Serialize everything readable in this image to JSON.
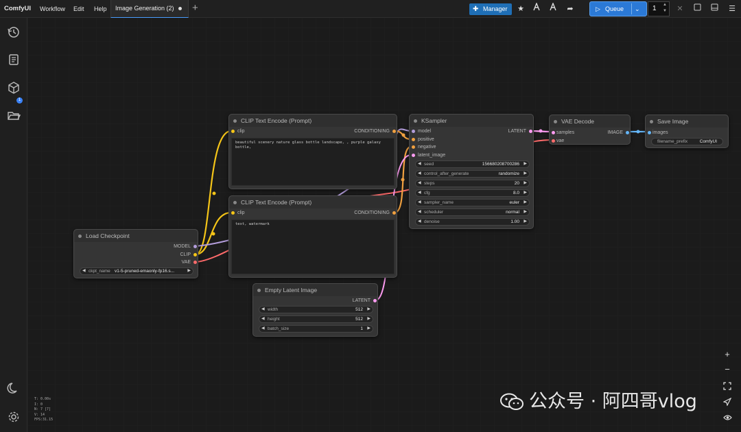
{
  "topbar": {
    "app_name": "ComfyUI",
    "menus": [
      "Workflow",
      "Edit",
      "Help"
    ],
    "tab_title": "Image Generation (2)",
    "manager_label": "Manager",
    "queue_label": "Queue",
    "queue_count": "1"
  },
  "sidebar": {
    "badge_count": "1"
  },
  "stats": [
    "T: 0.00s",
    "I: 0",
    "N: 7 [7]",
    "V: 14",
    "FPS:31.15"
  ],
  "colors": {
    "clip": "#f5c518",
    "conditioning": "#f0a040",
    "model": "#b39ddb",
    "vae": "#ff6b6b",
    "latent": "#ff9cf2",
    "image": "#64b5f6",
    "accent": "#2b79d6"
  },
  "nodes": {
    "clip_pos": {
      "title": "CLIP Text Encode (Prompt)",
      "in_clip": "clip",
      "out": "CONDITIONING",
      "text": "beautiful scenery nature glass bottle landscape, , purple galaxy bottle,"
    },
    "clip_neg": {
      "title": "CLIP Text Encode (Prompt)",
      "in_clip": "clip",
      "out": "CONDITIONING",
      "text": "text, watermark"
    },
    "checkpoint": {
      "title": "Load Checkpoint",
      "out_model": "MODEL",
      "out_clip": "CLIP",
      "out_vae": "VAE",
      "widget_name": "ckpt_name",
      "widget_value": "v1-5-pruned-emaonly-fp16.s..."
    },
    "latent": {
      "title": "Empty Latent Image",
      "out": "LATENT",
      "widgets": [
        {
          "name": "width",
          "value": "512"
        },
        {
          "name": "height",
          "value": "512"
        },
        {
          "name": "batch_size",
          "value": "1"
        }
      ]
    },
    "ksampler": {
      "title": "KSampler",
      "inputs": [
        "model",
        "positive",
        "negative",
        "latent_image"
      ],
      "out": "LATENT",
      "widgets": [
        {
          "name": "seed",
          "value": "156680208700286"
        },
        {
          "name": "control_after_generate",
          "value": "randomize"
        },
        {
          "name": "steps",
          "value": "20"
        },
        {
          "name": "cfg",
          "value": "8.0"
        },
        {
          "name": "sampler_name",
          "value": "euler"
        },
        {
          "name": "scheduler",
          "value": "normal"
        },
        {
          "name": "denoise",
          "value": "1.00"
        }
      ]
    },
    "vae_decode": {
      "title": "VAE Decode",
      "in_samples": "samples",
      "in_vae": "vae",
      "out": "IMAGE"
    },
    "save": {
      "title": "Save Image",
      "in_images": "images",
      "widget_name": "filename_prefix",
      "widget_value": "ComfyUI"
    }
  },
  "watermark": {
    "text": "公众号 · 阿四哥vlog"
  }
}
